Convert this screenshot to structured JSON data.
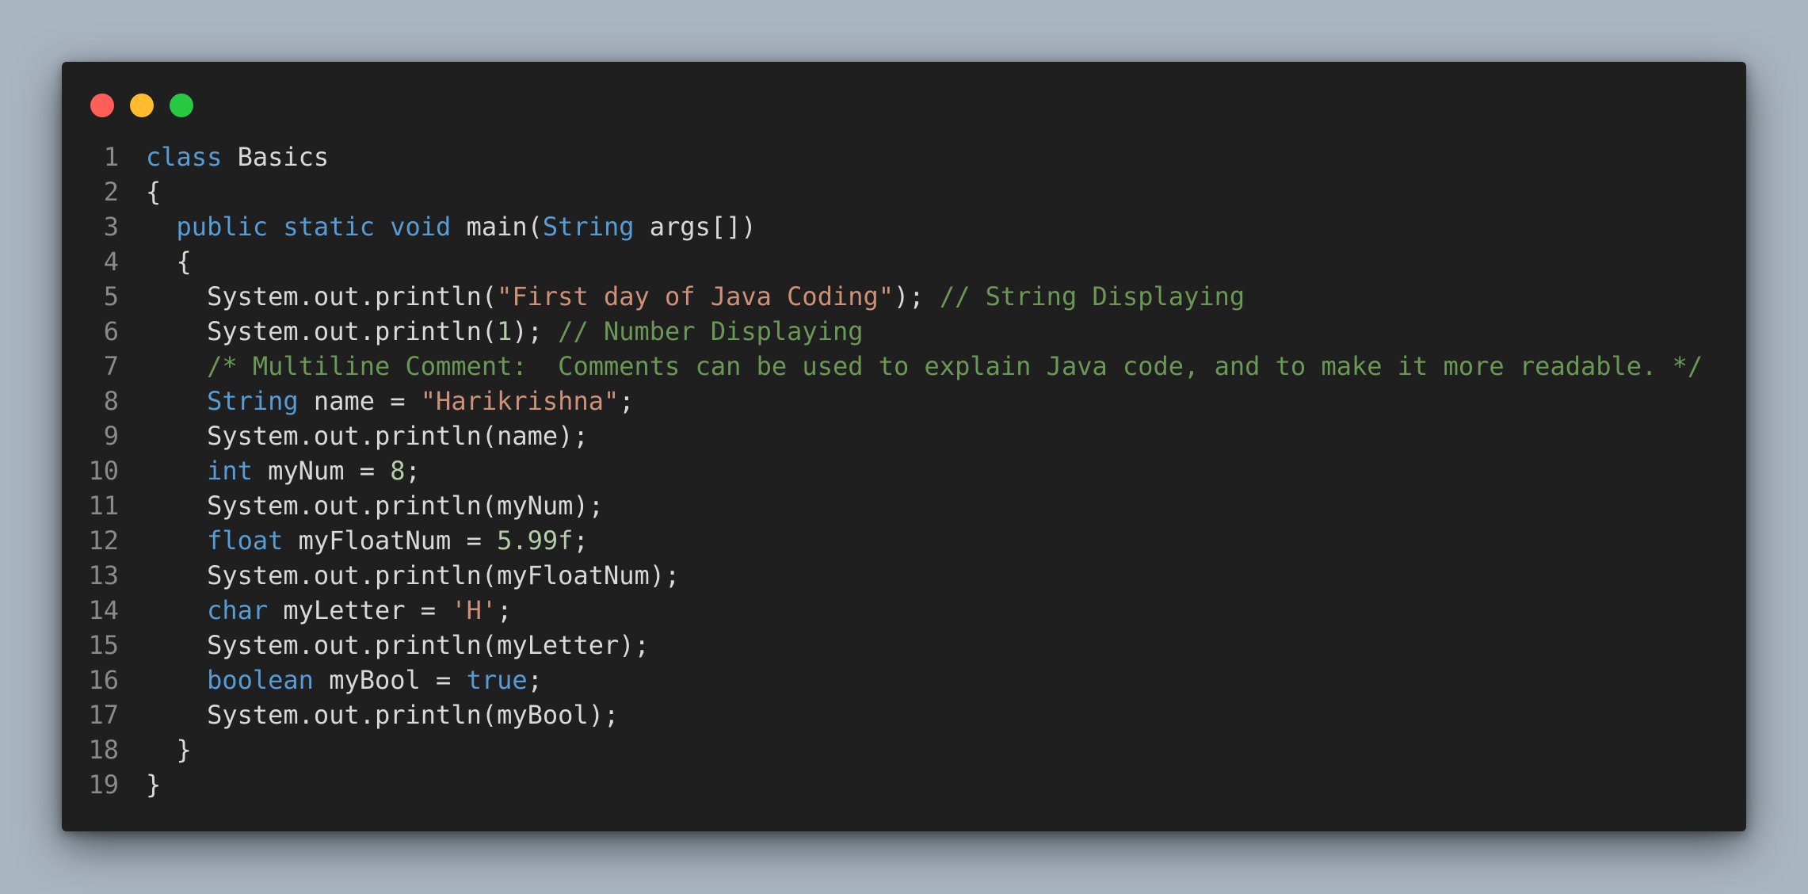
{
  "window": {
    "buttons": [
      {
        "name": "close",
        "color": "#ff5f57"
      },
      {
        "name": "minimize",
        "color": "#febc2e"
      },
      {
        "name": "maximize",
        "color": "#28c840"
      }
    ]
  },
  "theme": {
    "background": "#1f1f1f",
    "keyword": "#569cd6",
    "string": "#ce9178",
    "number": "#b5cea8",
    "comment": "#6a9955",
    "text": "#d9d9d9",
    "line_number": "#8a8a8a"
  },
  "code": {
    "lines": [
      {
        "n": "1",
        "tokens": [
          [
            "kw",
            "class"
          ],
          [
            "pl",
            " Basics"
          ]
        ]
      },
      {
        "n": "2",
        "tokens": [
          [
            "pl",
            "{"
          ]
        ]
      },
      {
        "n": "3",
        "tokens": [
          [
            "pl",
            "  "
          ],
          [
            "kw",
            "public"
          ],
          [
            "pl",
            " "
          ],
          [
            "kw",
            "static"
          ],
          [
            "pl",
            " "
          ],
          [
            "kw",
            "void"
          ],
          [
            "pl",
            " main("
          ],
          [
            "kw",
            "String"
          ],
          [
            "pl",
            " args[])"
          ]
        ]
      },
      {
        "n": "4",
        "tokens": [
          [
            "pl",
            "  {"
          ]
        ]
      },
      {
        "n": "5",
        "tokens": [
          [
            "pl",
            "    System.out.println("
          ],
          [
            "str",
            "\"First day of Java Coding\""
          ],
          [
            "pl",
            "); "
          ],
          [
            "cm",
            "// String Displaying"
          ]
        ]
      },
      {
        "n": "6",
        "tokens": [
          [
            "pl",
            "    System.out.println("
          ],
          [
            "num",
            "1"
          ],
          [
            "pl",
            "); "
          ],
          [
            "cm",
            "// Number Displaying"
          ]
        ]
      },
      {
        "n": "7",
        "tokens": [
          [
            "pl",
            "    "
          ],
          [
            "cm",
            "/* Multiline Comment:  Comments can be used to explain Java code, and to make it more readable. */"
          ]
        ]
      },
      {
        "n": "8",
        "tokens": [
          [
            "pl",
            "    "
          ],
          [
            "kw",
            "String"
          ],
          [
            "pl",
            " name = "
          ],
          [
            "str",
            "\"Harikrishna\""
          ],
          [
            "pl",
            ";"
          ]
        ]
      },
      {
        "n": "9",
        "tokens": [
          [
            "pl",
            "    System.out.println(name);"
          ]
        ]
      },
      {
        "n": "10",
        "tokens": [
          [
            "pl",
            "    "
          ],
          [
            "kw",
            "int"
          ],
          [
            "pl",
            " myNum = "
          ],
          [
            "num",
            "8"
          ],
          [
            "pl",
            ";"
          ]
        ]
      },
      {
        "n": "11",
        "tokens": [
          [
            "pl",
            "    System.out.println(myNum);"
          ]
        ]
      },
      {
        "n": "12",
        "tokens": [
          [
            "pl",
            "    "
          ],
          [
            "kw",
            "float"
          ],
          [
            "pl",
            " myFloatNum = "
          ],
          [
            "num",
            "5.99f"
          ],
          [
            "pl",
            ";"
          ]
        ]
      },
      {
        "n": "13",
        "tokens": [
          [
            "pl",
            "    System.out.println(myFloatNum);"
          ]
        ]
      },
      {
        "n": "14",
        "tokens": [
          [
            "pl",
            "    "
          ],
          [
            "kw",
            "char"
          ],
          [
            "pl",
            " myLetter = "
          ],
          [
            "str",
            "'H'"
          ],
          [
            "pl",
            ";"
          ]
        ]
      },
      {
        "n": "15",
        "tokens": [
          [
            "pl",
            "    System.out.println(myLetter);"
          ]
        ]
      },
      {
        "n": "16",
        "tokens": [
          [
            "pl",
            "    "
          ],
          [
            "kw",
            "boolean"
          ],
          [
            "pl",
            " myBool = "
          ],
          [
            "kw",
            "true"
          ],
          [
            "pl",
            ";"
          ]
        ]
      },
      {
        "n": "17",
        "tokens": [
          [
            "pl",
            "    System.out.println(myBool);"
          ]
        ]
      },
      {
        "n": "18",
        "tokens": [
          [
            "pl",
            "  }"
          ]
        ]
      },
      {
        "n": "19",
        "tokens": [
          [
            "pl",
            "}"
          ]
        ]
      }
    ]
  }
}
